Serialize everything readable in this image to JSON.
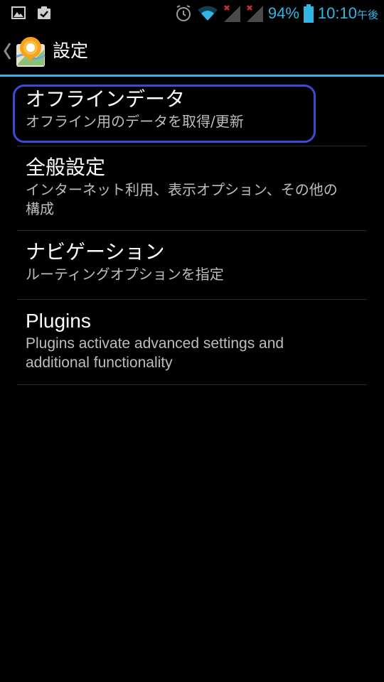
{
  "status_bar": {
    "left_icons": [
      "gallery-icon",
      "clipboard-check-icon"
    ],
    "right_icons": [
      "alarm-icon",
      "wifi-icon",
      "signal-no-service-icon",
      "signal-no-service-icon",
      "battery-icon"
    ],
    "battery_text": "94%",
    "time": "10:10",
    "time_suffix": "午後",
    "accent_color": "#33b5e5"
  },
  "action_bar": {
    "title": "設定",
    "up_icon": "chevron-left-icon",
    "app_icon": "map-pin-app-icon",
    "divider_color": "#33b5e5"
  },
  "preferences": [
    {
      "title": "オフラインデータ",
      "summary": "オフライン用のデータを取得/更新",
      "highlighted": true
    },
    {
      "title": "全般設定",
      "summary": "インターネット利用、表示オプション、その他の構成"
    },
    {
      "title": "ナビゲーション",
      "summary": "ルーティングオプションを指定"
    },
    {
      "title": "Plugins",
      "summary": "Plugins activate advanced settings and additional functionality"
    }
  ],
  "highlight_color": "#3d4ad3"
}
